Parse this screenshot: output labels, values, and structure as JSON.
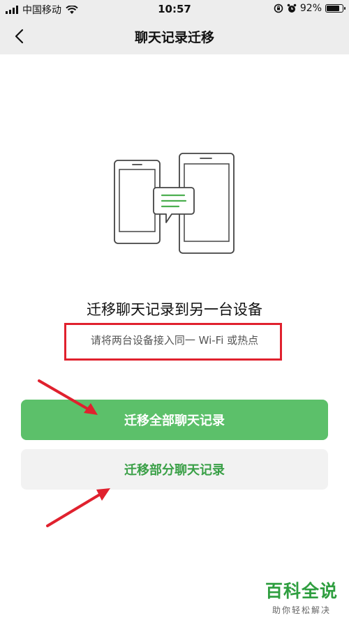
{
  "status_bar": {
    "carrier": "中国移动",
    "time": "10:57",
    "battery": "92%",
    "battery_level": 0.92
  },
  "nav": {
    "title": "聊天记录迁移"
  },
  "content": {
    "title": "迁移聊天记录到另一台设备",
    "hint": "请将两台设备接入同一 Wi-Fi 或热点"
  },
  "buttons": {
    "migrate_all": "迁移全部聊天记录",
    "migrate_partial": "迁移部分聊天记录"
  },
  "watermark": {
    "title": "百科全说",
    "subtitle": "助你轻松解决"
  },
  "colors": {
    "accent_green": "#5cc06a",
    "annotation_red": "#e0212e"
  },
  "icons": [
    "back-chevron-icon",
    "wifi-icon",
    "alarm-icon",
    "lock-rotation-icon",
    "battery-icon",
    "signal-icon"
  ]
}
